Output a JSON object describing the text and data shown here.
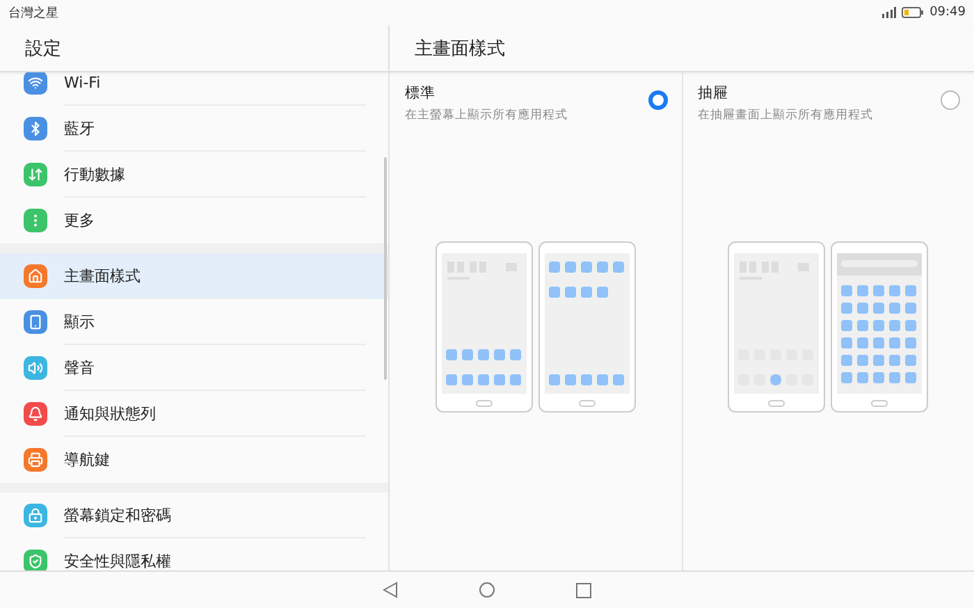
{
  "status_bar": {
    "carrier": "台灣之星",
    "time": "09:49"
  },
  "sidebar": {
    "title": "設定",
    "groups": [
      {
        "items": [
          {
            "label": "Wi-Fi",
            "color": "#4a90e2",
            "selected": false
          },
          {
            "label": "藍牙",
            "color": "#4a90e2",
            "selected": false
          },
          {
            "label": "行動數據",
            "color": "#3cc46a",
            "selected": false
          },
          {
            "label": "更多",
            "color": "#3cc46a",
            "selected": false
          }
        ]
      },
      {
        "items": [
          {
            "label": "主畫面樣式",
            "color": "#f5782a",
            "selected": true
          },
          {
            "label": "顯示",
            "color": "#4a90e2",
            "selected": false
          },
          {
            "label": "聲音",
            "color": "#3bb6e0",
            "selected": false
          },
          {
            "label": "通知與狀態列",
            "color": "#f24b4b",
            "selected": false
          },
          {
            "label": "導航鍵",
            "color": "#f5782a",
            "selected": false
          }
        ]
      },
      {
        "items": [
          {
            "label": "螢幕鎖定和密碼",
            "color": "#3bb6e0",
            "selected": false
          },
          {
            "label": "安全性與隱私權",
            "color": "#3cc46a",
            "selected": false
          }
        ]
      }
    ]
  },
  "detail": {
    "title": "主畫面樣式",
    "options": [
      {
        "title": "標準",
        "description": "在主螢幕上顯示所有應用程式",
        "kind": "standard",
        "selected": true
      },
      {
        "title": "抽屜",
        "description": "在抽屜畫面上顯示所有應用程式",
        "kind": "drawer",
        "selected": false
      }
    ]
  }
}
